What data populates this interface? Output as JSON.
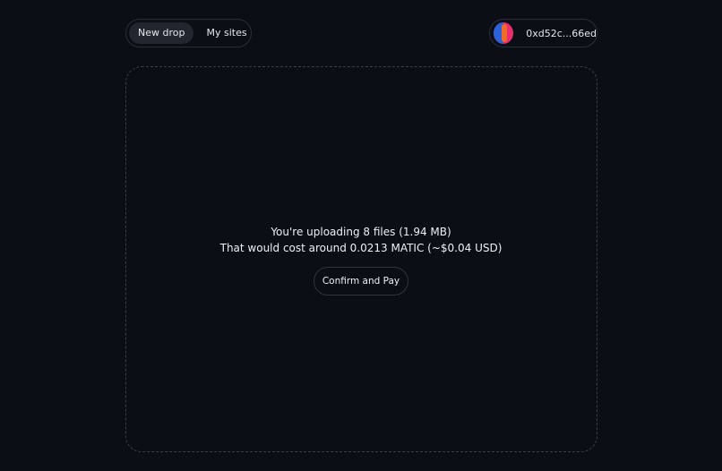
{
  "tabs": [
    {
      "label": "New drop",
      "active": true
    },
    {
      "label": "My sites",
      "active": false
    }
  ],
  "wallet": {
    "address": "0xd52c...66ed"
  },
  "upload": {
    "summary": "You're uploading 8 files (1.94 MB)",
    "cost": "That would cost around 0.0213 MATIC (~$0.04 USD)",
    "confirm_label": "Confirm and Pay"
  }
}
